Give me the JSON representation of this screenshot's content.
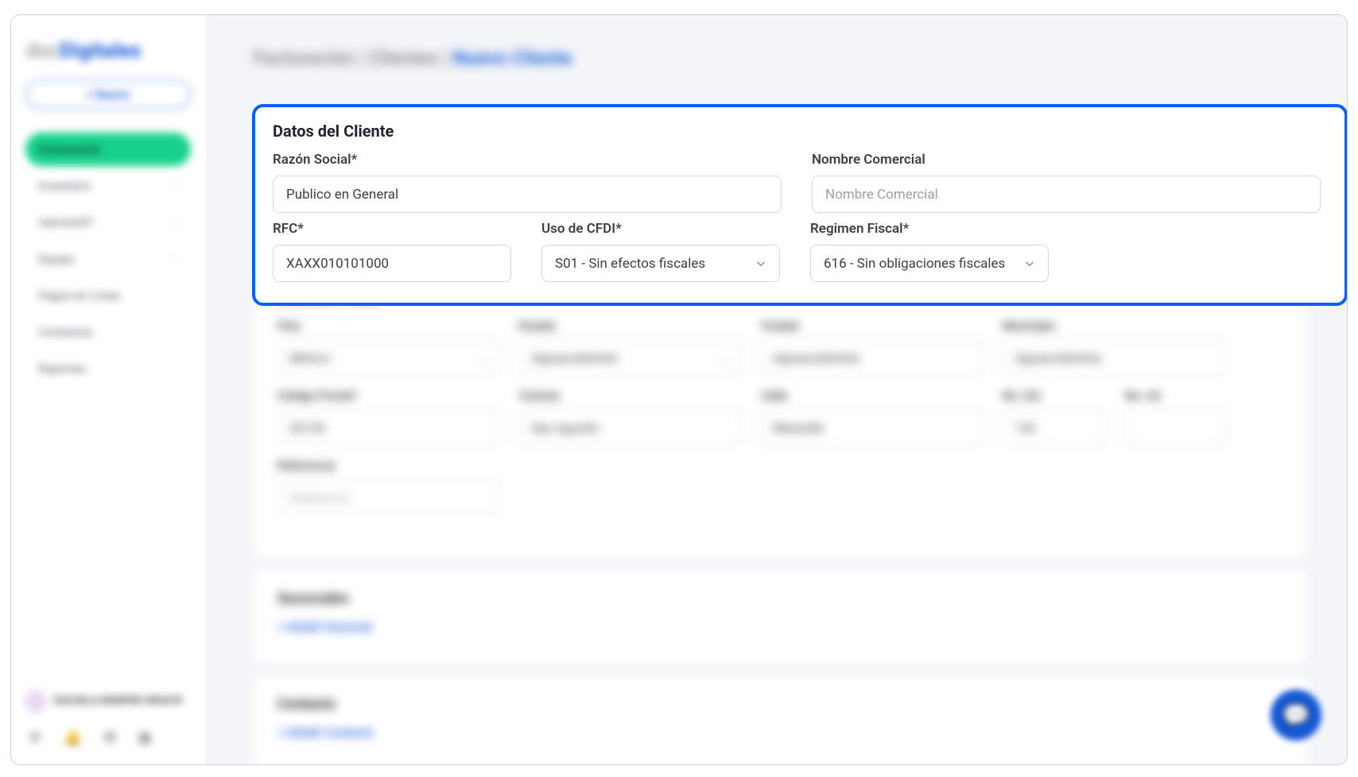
{
  "logo": {
    "part1": "doc",
    "part2": "Digitales",
    "suffix": ""
  },
  "sidebar": {
    "nuevo": "+ Nuevo",
    "items": [
      {
        "label": "Facturación",
        "active": true
      },
      {
        "label": "Inventario"
      },
      {
        "label": "AdminSAT"
      },
      {
        "label": "Equipo"
      },
      {
        "label": "Pagos en Línea"
      },
      {
        "label": "Contactos"
      },
      {
        "label": "Reportes"
      }
    ],
    "user": "ESCUELA KEMPER URGATE"
  },
  "breadcrumb": {
    "a": "Facturación",
    "b": "Clientes",
    "c": "Nuevo Cliente"
  },
  "highlight": {
    "title": "Datos del Cliente",
    "razon_label": "Razón Social*",
    "razon_value": "Publico en General",
    "nombrecom_label": "Nombre Comercial",
    "nombrecom_placeholder": "Nombre Comercial",
    "rfc_label": "RFC*",
    "rfc_value": "XAXX010101000",
    "cfdi_label": "Uso de CFDI*",
    "cfdi_value": "S01 - Sin efectos fiscales",
    "regimen_label": "Regimen Fiscal*",
    "regimen_value": "616 - Sin obligaciones fiscales"
  },
  "address": {
    "title": "Dirección Fiscal",
    "pais_l": "País",
    "pais_v": "México",
    "estado_l": "Estado",
    "estado_v": "Aguascalientes",
    "ciudad_l": "Ciudad",
    "ciudad_v": "Aguascalientes",
    "municipio_l": "Municipio",
    "municipio_v": "Aguascalientes",
    "cp_l": "Código Postal*",
    "cp_v": "20130",
    "colonia_l": "Colonia",
    "colonia_v": "San Agustín",
    "calle_l": "Calle",
    "calle_v": "Miravalle",
    "noext_l": "No. Ext",
    "noext_v": "142",
    "noint_l": "No. Int",
    "noint_v": "",
    "ref_l": "Referencia",
    "ref_ph": "Referencia"
  },
  "sucursales": {
    "title": "Sucursales",
    "add": "+ Añadir Sucursal"
  },
  "contacto": {
    "title": "Contacto",
    "add": "+ Añadir Contacto"
  }
}
